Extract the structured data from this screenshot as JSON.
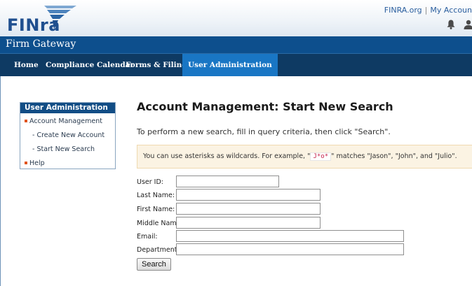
{
  "header": {
    "logo_text": "FINra",
    "util_links": [
      "FINRA.org",
      "My Accoun"
    ],
    "util_separator": "|",
    "icons": [
      "bell-icon",
      "user-icon"
    ]
  },
  "app": {
    "title": "Firm Gateway"
  },
  "nav": {
    "items": [
      {
        "label": "Home"
      },
      {
        "label": "Compliance Calendar"
      },
      {
        "label": "Forms & Filings"
      },
      {
        "label": "User Administration",
        "active": true
      }
    ]
  },
  "sidebar": {
    "heading": "User Administration",
    "items": [
      {
        "label": "Account Management"
      },
      {
        "label": "- Create New Account"
      },
      {
        "label": "- Start New Search"
      },
      {
        "label": "Help"
      }
    ]
  },
  "main": {
    "title": "Account Management: Start New Search",
    "instructions": "To perform a new search, fill in query criteria, then click \"Search\".",
    "notice": {
      "prefix": "You can use asterisks as wildcards. For example, \"",
      "example": "J*o*",
      "suffix": "\" matches \"Jason\", \"John\", and \"Julio\"."
    }
  },
  "form": {
    "fields": [
      {
        "label": "User ID:",
        "value": ""
      },
      {
        "label": "Last Name:",
        "value": ""
      },
      {
        "label": "First Name:",
        "value": ""
      },
      {
        "label": "Middle Name:",
        "value": ""
      },
      {
        "label": "Email:",
        "value": ""
      },
      {
        "label": "Department:",
        "value": ""
      }
    ],
    "search_label": "Search"
  },
  "colors": {
    "brand_blue": "#0d4f8d",
    "nav_dark": "#0e3a63",
    "nav_active": "#1976c4",
    "bullet_orange": "#e0541f",
    "notice_bg": "#fbf3e3"
  }
}
